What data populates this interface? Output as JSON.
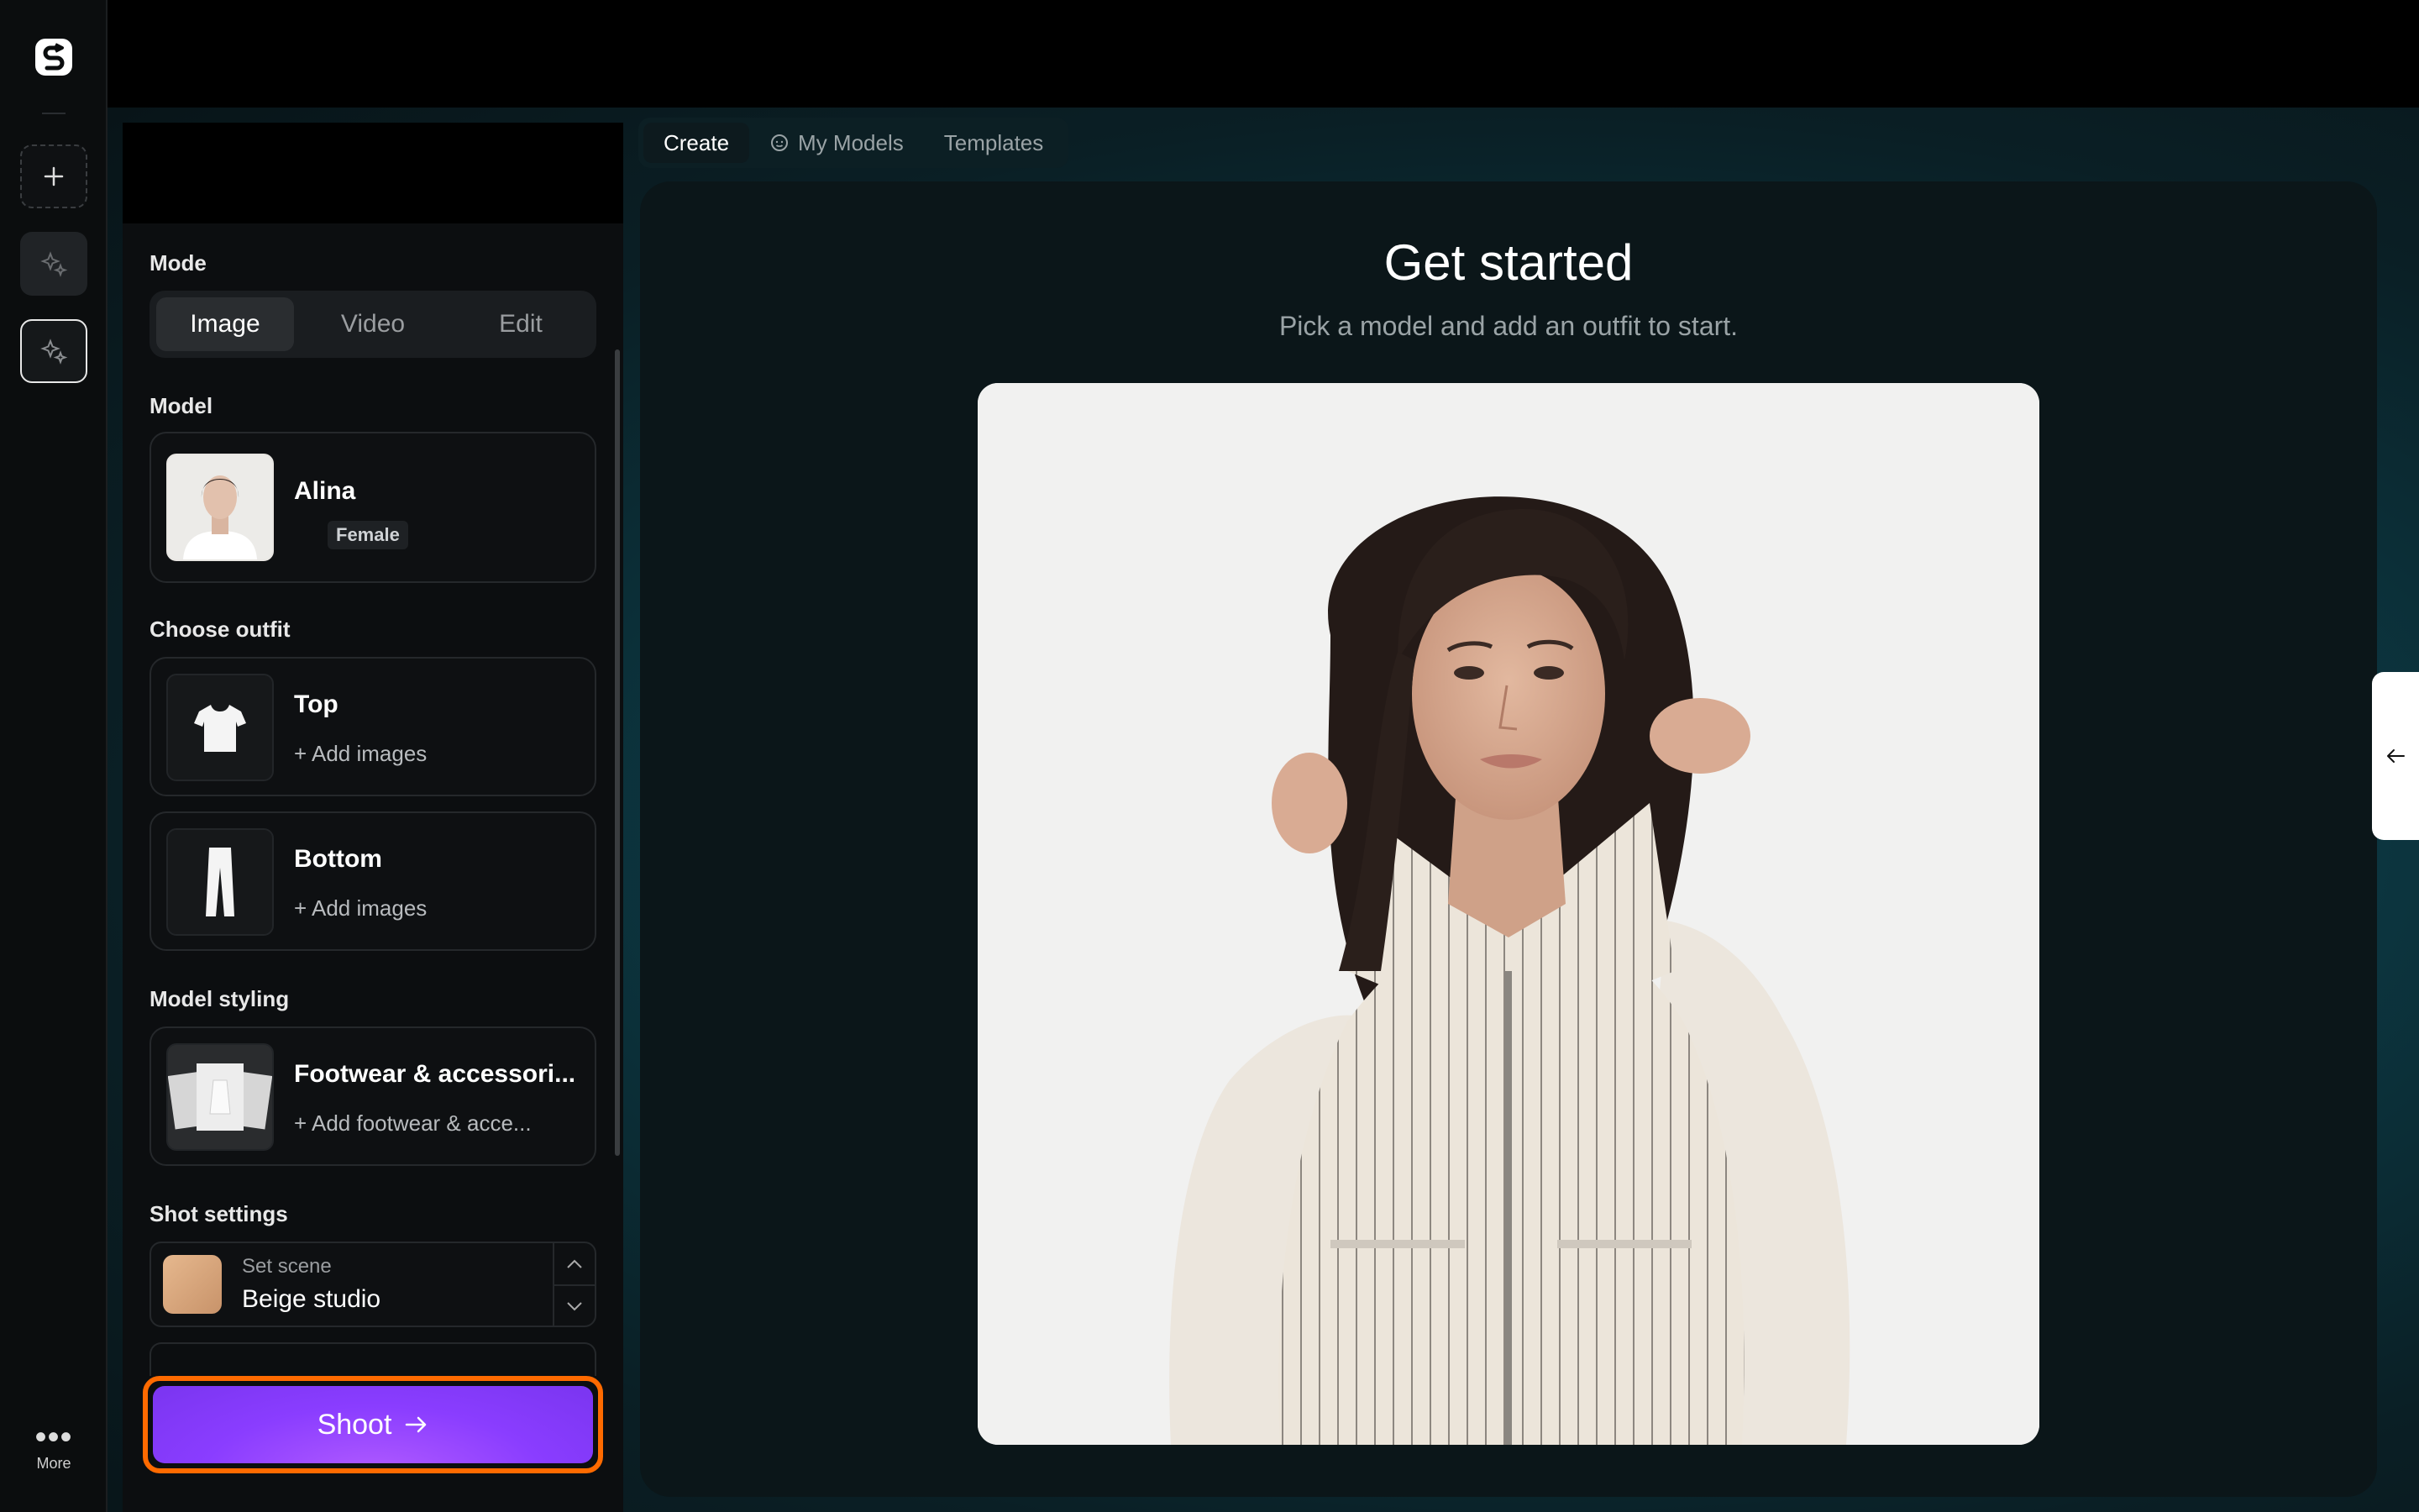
{
  "rail": {
    "more_label": "More"
  },
  "tabs": [
    {
      "label": "Create"
    },
    {
      "label": "My Models"
    },
    {
      "label": "Templates"
    }
  ],
  "panel": {
    "mode_label": "Mode",
    "modes": [
      "Image",
      "Video",
      "Edit"
    ],
    "model_label": "Model",
    "model": {
      "name": "Alina",
      "gender": "Female"
    },
    "outfit_label": "Choose outfit",
    "outfit": [
      {
        "title": "Top",
        "action": "Add images"
      },
      {
        "title": "Bottom",
        "action": "Add images"
      }
    ],
    "styling_label": "Model styling",
    "styling": {
      "title": "Footwear & accessori...",
      "action": "Add footwear & acce..."
    },
    "shot_label": "Shot settings",
    "scene": {
      "key": "Set scene",
      "value": "Beige studio"
    },
    "shoot_label": "Shoot"
  },
  "content": {
    "title": "Get started",
    "subtitle": "Pick a model and add an outfit to start."
  },
  "colors": {
    "accent": "#8a3dff",
    "focus_ring": "#ff6a00",
    "scene_swatch": "#d9a77c"
  }
}
